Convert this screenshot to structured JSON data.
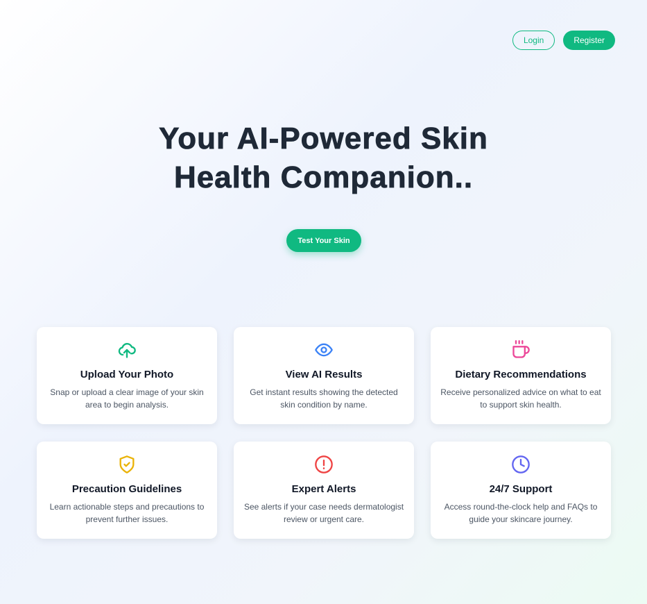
{
  "nav": {
    "login_label": "Login",
    "register_label": "Register"
  },
  "hero": {
    "title_line1": "Your AI-Powered Skin",
    "title_line2": "Health Companion..",
    "cta_label": "Test Your Skin"
  },
  "colors": {
    "accent": "#10b981",
    "heading": "#1f2937"
  },
  "features": [
    {
      "icon": "cloud-upload-icon",
      "color": "#10b981",
      "title": "Upload Your Photo",
      "desc": "Snap or upload a clear image of your skin area to begin analysis."
    },
    {
      "icon": "eye-icon",
      "color": "#3b82f6",
      "title": "View AI Results",
      "desc": "Get instant results showing the detected skin condition by name."
    },
    {
      "icon": "coffee-cup-icon",
      "color": "#ec4899",
      "title": "Dietary Recommendations",
      "desc": "Receive personalized advice on what to eat to support skin health."
    },
    {
      "icon": "shield-check-icon",
      "color": "#eab308",
      "title": "Precaution Guidelines",
      "desc": "Learn actionable steps and precautions to prevent further issues."
    },
    {
      "icon": "alert-circle-icon",
      "color": "#ef4444",
      "title": "Expert Alerts",
      "desc": "See alerts if your case needs dermatologist review or urgent care."
    },
    {
      "icon": "clock-icon",
      "color": "#6366f1",
      "title": "24/7 Support",
      "desc": "Access round-the-clock help and FAQs to guide your skincare journey."
    }
  ]
}
